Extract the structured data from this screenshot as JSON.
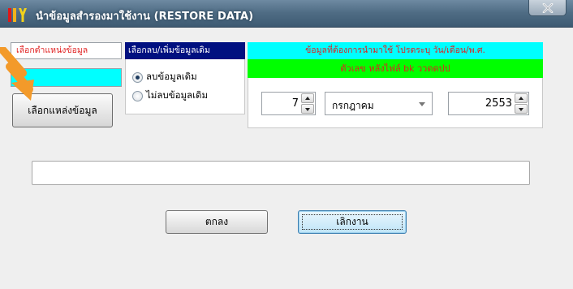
{
  "window": {
    "title": "นำข้อมูลสำรองมาใช้งาน (RESTORE DATA)",
    "close_label": "X"
  },
  "source": {
    "header": "เลือกตำแหน่งข้อมูล",
    "path_value": "",
    "button_label": "เลือกแหล่งข้อมูล"
  },
  "mode": {
    "header": "เลือกลบ/เพิ่มข้อมูลเดิม",
    "options": [
      {
        "label": "ลบข้อมูลเดิม",
        "checked": true
      },
      {
        "label": "ไม่ลบข้อมูลเดิม",
        "checked": false
      }
    ]
  },
  "date": {
    "header": "ข้อมูลที่ต้องการนำมาใช้ โปรดระบุ วัน/เดือน/พ.ศ.",
    "subheader": "ตัวเลข หลังไฟล์ bk ววดดปป",
    "day": "7",
    "month": "กรกฎาคม",
    "year": "2553"
  },
  "status": {
    "value": ""
  },
  "actions": {
    "ok_label": "ตกลง",
    "cancel_label": "เลิกงาน"
  },
  "colors": {
    "cyan": "#00ffff",
    "green": "#00ff00",
    "navy": "#001080",
    "red_text": "#e02020",
    "arrow_orange": "#f39a2a"
  }
}
